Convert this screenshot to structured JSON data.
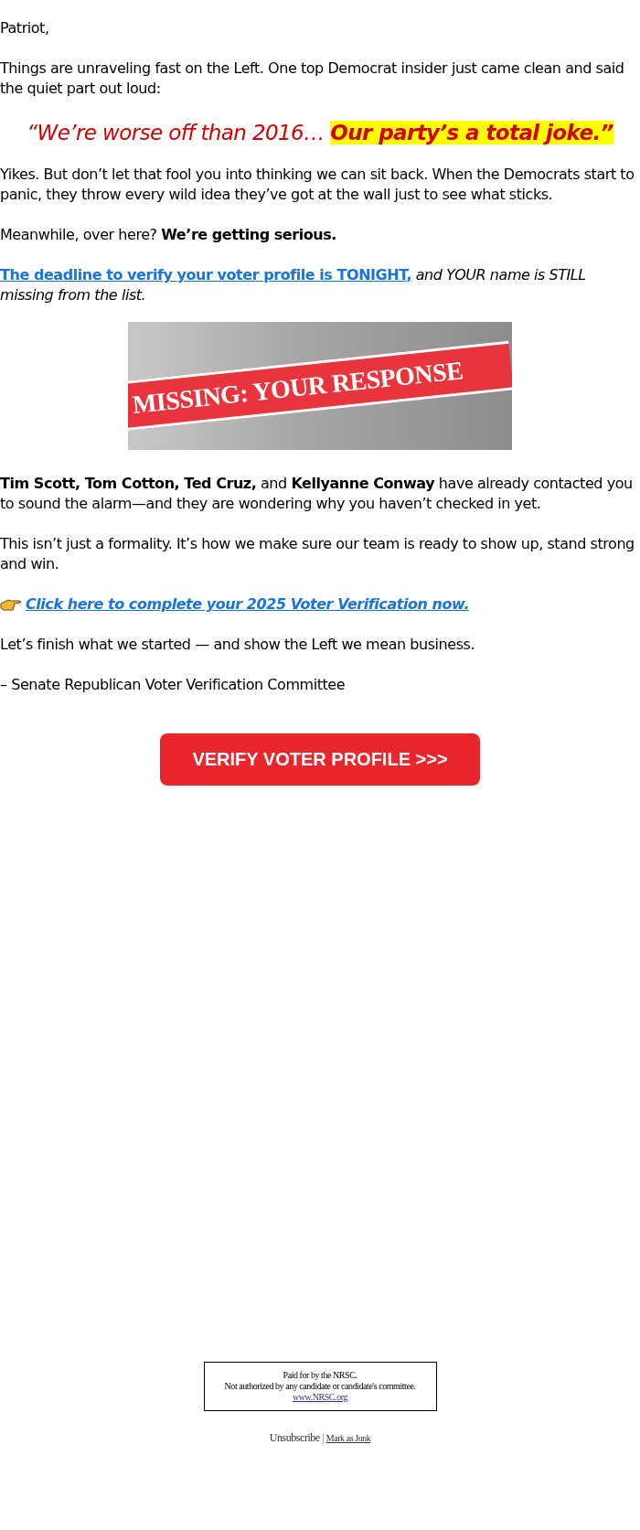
{
  "greeting": "Patriot,",
  "intro": "Things are unraveling fast on the Left. One top Democrat insider just came clean and said the quiet part out loud:",
  "quote": "“We’re worse off than 2016… **Our party’s a total joke.”**",
  "paragraph_2": "Yikes. But don’t let that fool you into thinking we can sit back. When the Democrats start to panic, they throw every wild idea they’ve got at the wall just to see what sticks.",
  "paragraph_3": "Meanwhile, over here? **We’re getting serious.**",
  "deadline": {
    "link": "The deadline to verify your voter profile is TONIGHT,",
    "rest": "and YOUR name is STILL missing from the list."
  },
  "banner_image": {
    "text": "MISSING: YOUR RESPONSE"
  },
  "paragraph_4": "**Tim Scott, Tom Cotton, Ted Cruz,** and **Kellyanne Conway** have already contacted you to sound the alarm—and they are wondering why you haven’t checked in yet.",
  "paragraph_5": "This isn’t just a formality. It’s how we make sure our team is ready to show up, stand strong and win.",
  "cta_link": "Click here to complete your 2025 Voter Verification now.",
  "paragraph_6": "Let’s finish what we started — and show the Left we mean business.",
  "signature": "– Senate Republican Voter Verification Committee",
  "button": "VERIFY VOTER PROFILE >>>",
  "disclaimer": {
    "lines": [
      "Paid for by the NRSC.",
      "Not authorized by any candidate or candidate's committee."
    ],
    "link": "www.NRSC.org"
  },
  "footer": {
    "unsubscribe": "Unsubscribe",
    "separator": "|",
    "junk": "Mark as Junk"
  }
}
